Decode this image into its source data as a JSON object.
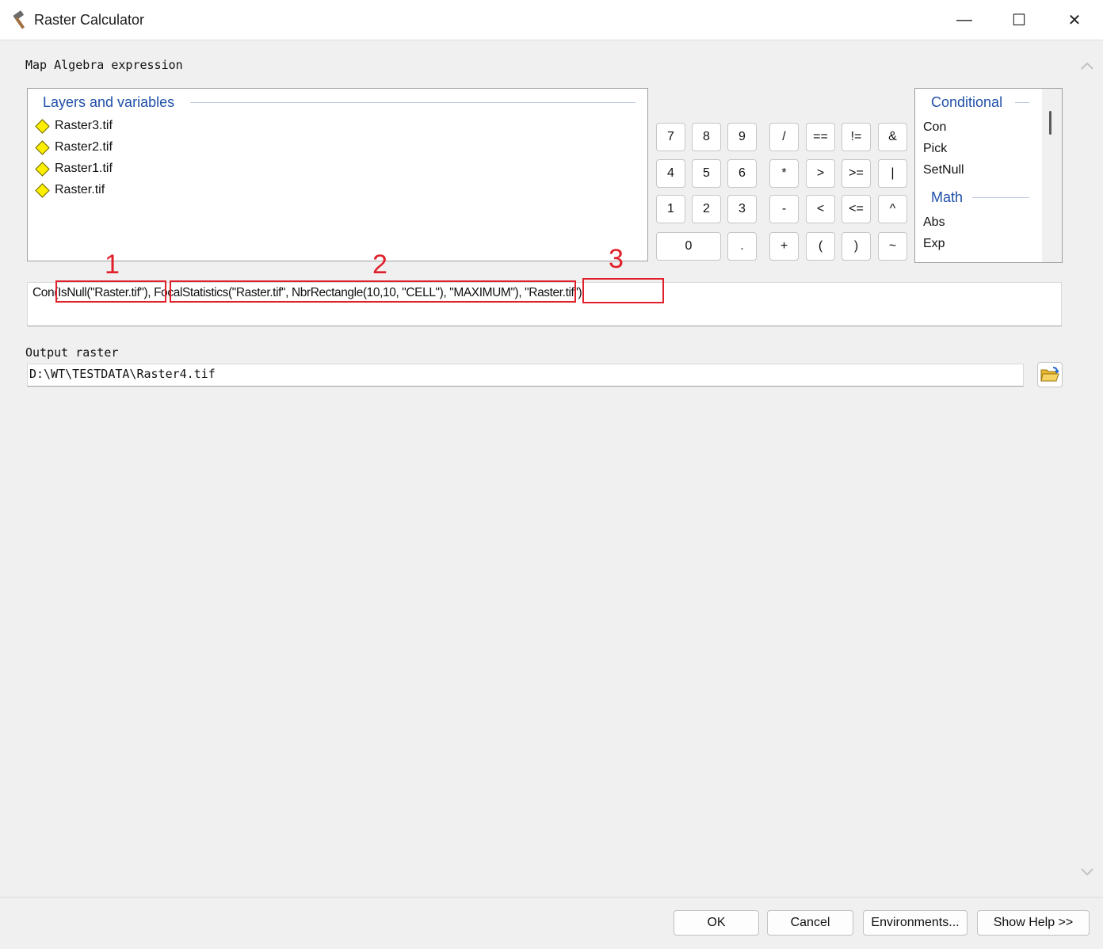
{
  "window": {
    "title": "Raster Calculator",
    "minimize": "—",
    "maximize": "☐",
    "close": "✕"
  },
  "expression_label": "Map Algebra expression",
  "layers": {
    "title": "Layers and variables",
    "items": [
      "Raster3.tif",
      "Raster2.tif",
      "Raster1.tif",
      "Raster.tif"
    ]
  },
  "keypad": {
    "rows": [
      [
        "7",
        "8",
        "9",
        "/",
        "==",
        "!=",
        "&"
      ],
      [
        "4",
        "5",
        "6",
        "*",
        ">",
        ">=",
        "|"
      ],
      [
        "1",
        "2",
        "3",
        "-",
        "<",
        "<=",
        "^"
      ],
      [
        "0",
        ".",
        "+",
        "(",
        ")",
        "~"
      ]
    ]
  },
  "functions": {
    "groups": [
      {
        "title": "Conditional",
        "items": [
          "Con",
          "Pick",
          "SetNull"
        ]
      },
      {
        "title": "Math",
        "items": [
          "Abs",
          "Exp"
        ]
      }
    ]
  },
  "expression": {
    "prefix": "Con",
    "part1": "(IsNull(\"Raster.tif\")",
    "sep1": ",",
    "part2": "FocalStatistics(\"Raster.tif\", NbrRectangle(10,10, \"CELL\"), \"MAXIMUM\")",
    "sep2": ",",
    "part3": "\"Raster.tif\")"
  },
  "annotations": [
    "1",
    "2",
    "3"
  ],
  "annotation_color": "#e0202a",
  "output": {
    "label": "Output raster",
    "value": "D:\\WT\\TESTDATA\\Raster4.tif"
  },
  "footer": {
    "ok": "OK",
    "cancel": "Cancel",
    "environments": "Environments...",
    "help": "Show Help >>"
  },
  "colors": {
    "group_title": "#1f4fa8",
    "layer_icon": "#ffee00"
  },
  "icons": {
    "title": "hammer-icon",
    "layer": "raster-layer-icon",
    "browse": "folder-open-icon"
  }
}
